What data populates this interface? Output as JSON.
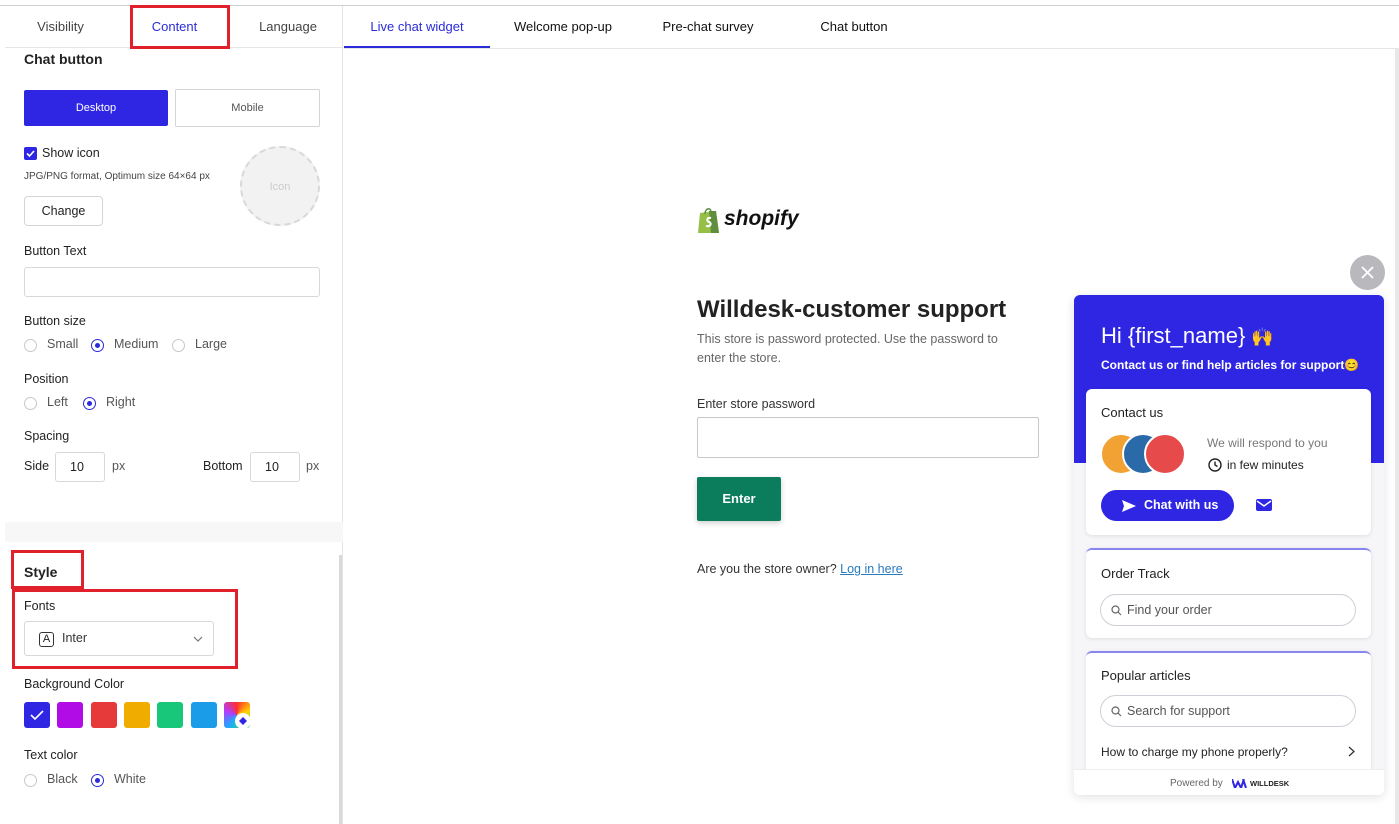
{
  "left_tabs": [
    {
      "label": "Visibility"
    },
    {
      "label": "Content"
    },
    {
      "label": "Language"
    }
  ],
  "chat_button": {
    "title": "Chat button",
    "desktop_label": "Desktop",
    "mobile_label": "Mobile",
    "show_icon_label": "Show icon",
    "format_note": "JPG/PNG format, Optimum size 64×64 px",
    "change_label": "Change",
    "icon_placeholder": "Icon",
    "button_text_label": "Button Text",
    "button_text_value": "",
    "button_size_label": "Button size",
    "sizes": [
      "Small",
      "Medium",
      "Large"
    ],
    "selected_size": "Medium",
    "position_label": "Position",
    "positions": [
      "Left",
      "Right"
    ],
    "selected_position": "Right",
    "spacing_label": "Spacing",
    "side_label": "Side",
    "side_value": "10",
    "bottom_label": "Bottom",
    "bottom_value": "10",
    "px_label": "px"
  },
  "style": {
    "title": "Style",
    "fonts_label": "Fonts",
    "font_value": "Inter",
    "font_icon_letter": "A",
    "bg_color_label": "Background Color",
    "swatches": [
      "#2f26e4",
      "#b10be6",
      "#e63a3a",
      "#f0ad00",
      "#18c77a",
      "#1a9ce8"
    ],
    "text_color_label": "Text color",
    "text_colors": [
      "Black",
      "White"
    ],
    "selected_text_color": "White"
  },
  "right_tabs": [
    {
      "label": "Live chat widget"
    },
    {
      "label": "Welcome pop-up"
    },
    {
      "label": "Pre-chat survey"
    },
    {
      "label": "Chat button"
    }
  ],
  "store": {
    "logo_text": "shopify",
    "heading": "Willdesk-customer support",
    "desc_line1": "This store is password protected. Use the password to",
    "desc_line2": "enter the store.",
    "password_label": "Enter store password",
    "enter_label": "Enter",
    "owner_text": "Are you the store owner?",
    "login_link": "Log in here"
  },
  "widget": {
    "greeting": "Hi {first_name}",
    "greeting_emoji": "🙌",
    "subtitle": "Contact us or find help articles for support",
    "subtitle_emoji": "😊",
    "contact_title": "Contact us",
    "respond_line1": "We will respond to you",
    "respond_line2": "in few minutes",
    "chat_button": "Chat with us",
    "order_title": "Order Track",
    "order_placeholder": "Find your order",
    "articles_title": "Popular articles",
    "articles_placeholder": "Search for support",
    "article_item": "How to charge my phone properly?",
    "powered_by": "Powered by",
    "brand": "WILLDESK"
  }
}
